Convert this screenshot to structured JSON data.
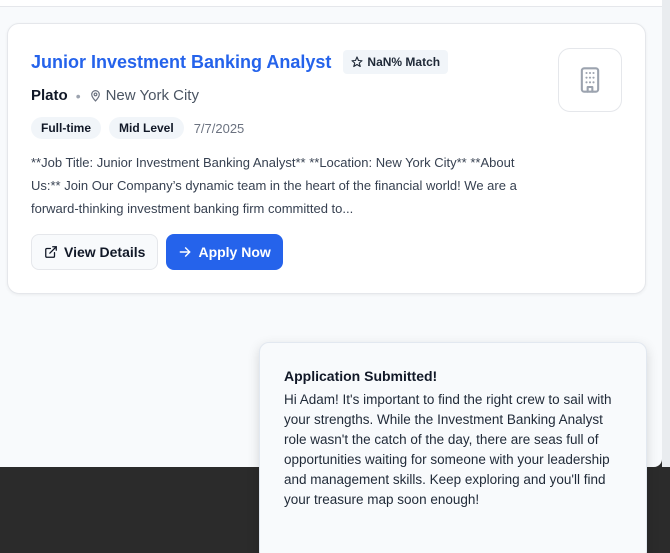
{
  "job": {
    "title": "Junior Investment Banking Analyst",
    "match_label": "NaN% Match",
    "company": "Plato",
    "separator": "•",
    "location": "New York City",
    "tags": [
      "Full-time",
      "Mid Level"
    ],
    "date": "7/7/2025",
    "description": "**Job Title: Junior Investment Banking Analyst** **Location: New York City** **About Us:** Join Our Company’s dynamic team in the heart of the financial world! We are a forward-thinking investment banking firm committed to...",
    "view_label": "View Details",
    "apply_label": "Apply Now"
  },
  "toast": {
    "title": "Application Submitted!",
    "message": "Hi Adam! It's important to find the right crew to sail with your strengths. While the Investment Banking Analyst role wasn't the catch of the day, there are seas full of opportunities waiting for someone with your leadership and management skills. Keep exploring and you'll find your treasure map soon enough!"
  },
  "colors": {
    "accent": "#2563eb",
    "tag_bg": "#f1f5f9"
  },
  "icons": [
    "star-icon",
    "map-pin-icon",
    "external-link-icon",
    "arrow-right-icon",
    "building-icon"
  ]
}
